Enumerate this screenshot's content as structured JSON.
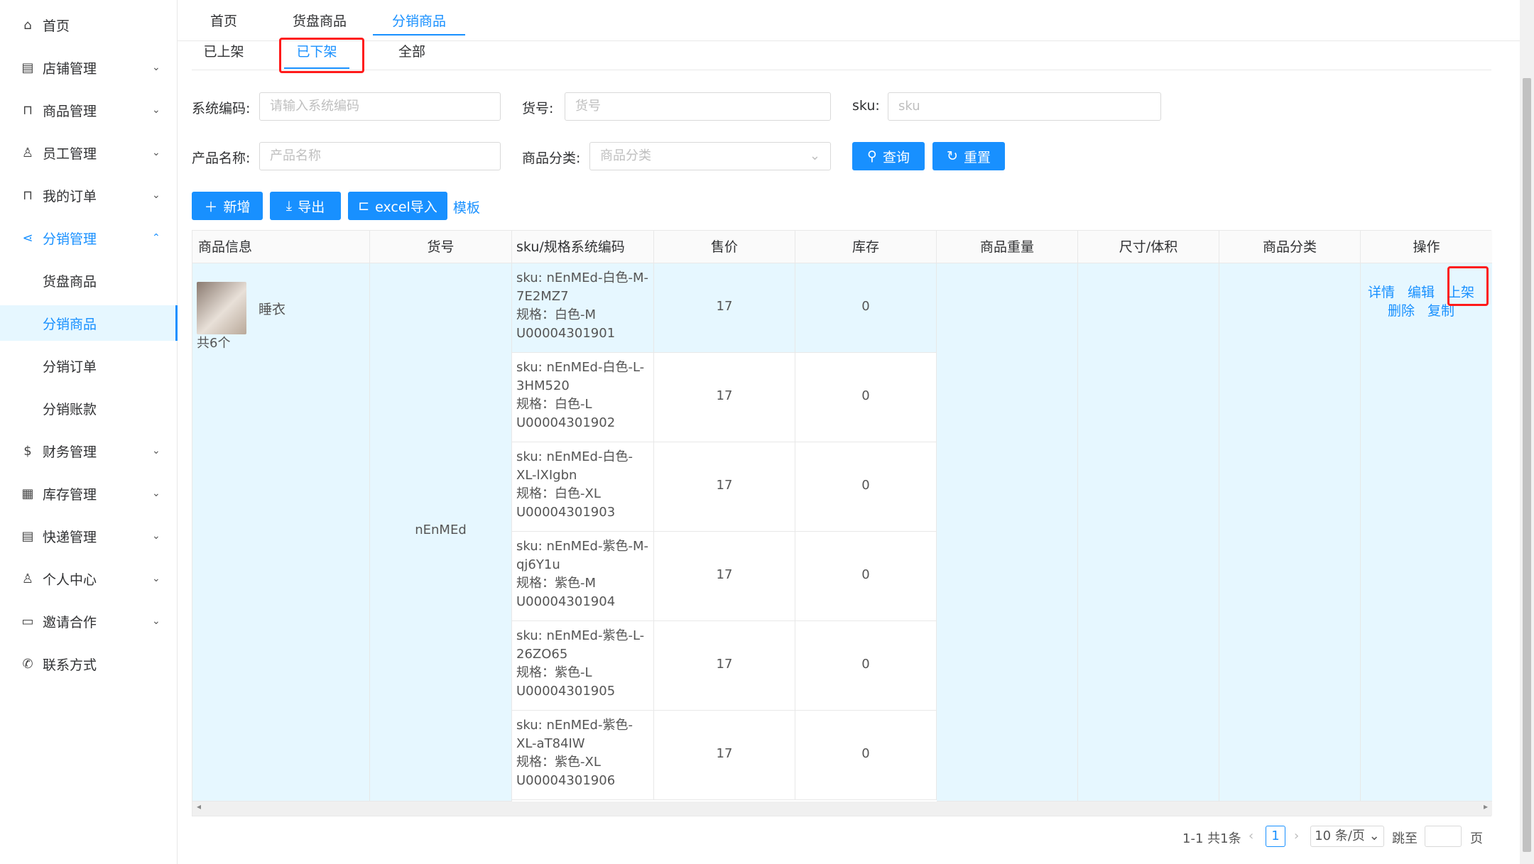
{
  "sidebar": {
    "items": [
      {
        "label": "首页",
        "icon": "home-icon"
      },
      {
        "label": "店铺管理",
        "icon": "shop-icon"
      },
      {
        "label": "商品管理",
        "icon": "bag-icon"
      },
      {
        "label": "员工管理",
        "icon": "user-icon"
      },
      {
        "label": "我的订单",
        "icon": "bag-icon"
      },
      {
        "label": "分销管理",
        "icon": "share-icon"
      },
      {
        "label": "货盘商品"
      },
      {
        "label": "分销商品"
      },
      {
        "label": "分销订单"
      },
      {
        "label": "分销账款"
      },
      {
        "label": "财务管理",
        "icon": "dollar-icon"
      },
      {
        "label": "库存管理",
        "icon": "table-icon"
      },
      {
        "label": "快递管理",
        "icon": "list-icon"
      },
      {
        "label": "个人中心",
        "icon": "user-icon"
      },
      {
        "label": "邀请合作",
        "icon": "laptop-icon"
      },
      {
        "label": "联系方式",
        "icon": "phone-icon"
      }
    ]
  },
  "top_tabs": [
    "首页",
    "货盘商品",
    "分销商品"
  ],
  "sub_tabs": [
    "已上架",
    "已下架",
    "全部"
  ],
  "filters": {
    "system_code": {
      "label": "系统编码:",
      "placeholder": "请输入系统编码"
    },
    "item_no": {
      "label": "货号:",
      "placeholder": "货号"
    },
    "sku": {
      "label": "sku:",
      "placeholder": "sku"
    },
    "product_name": {
      "label": "产品名称:",
      "placeholder": "产品名称"
    },
    "category": {
      "label": "商品分类:",
      "placeholder": "商品分类"
    },
    "query_label": "查询",
    "reset_label": "重置"
  },
  "actions": {
    "add": "新增",
    "export": "导出",
    "excel_import": "excel导入",
    "template": "模板"
  },
  "table": {
    "headers": [
      "商品信息",
      "货号",
      "sku/规格系统编码",
      "售价",
      "库存",
      "商品重量",
      "尺寸/体积",
      "商品分类",
      "操作"
    ],
    "product": {
      "name": "睡衣",
      "count": "共6个",
      "item_no": "nEnMEd"
    },
    "rows": [
      {
        "sku": "sku: nEnMEd-白色-M-7E2MZ7",
        "spec": "规格：白色-M",
        "code": "U00004301901",
        "price": "17",
        "stock": "0"
      },
      {
        "sku": "sku: nEnMEd-白色-L-3HM520",
        "spec": "规格：白色-L",
        "code": "U00004301902",
        "price": "17",
        "stock": "0"
      },
      {
        "sku": "sku: nEnMEd-白色-XL-lXIgbn",
        "spec": "规格：白色-XL",
        "code": "U00004301903",
        "price": "17",
        "stock": "0"
      },
      {
        "sku": "sku: nEnMEd-紫色-M-qj6Y1u",
        "spec": "规格：紫色-M",
        "code": "U00004301904",
        "price": "17",
        "stock": "0"
      },
      {
        "sku": "sku: nEnMEd-紫色-L-26ZO65",
        "spec": "规格：紫色-L",
        "code": "U00004301905",
        "price": "17",
        "stock": "0"
      },
      {
        "sku": "sku: nEnMEd-紫色-XL-aT84IW",
        "spec": "规格：紫色-XL",
        "code": "U00004301906",
        "price": "17",
        "stock": "0"
      }
    ],
    "ops": {
      "detail": "详情",
      "edit": "编辑",
      "shelve": "上架",
      "delete": "删除",
      "copy": "复制"
    }
  },
  "pagination": {
    "summary": "1-1 共1条",
    "current": "1",
    "page_size": "10 条/页",
    "jump_label": "跳至",
    "page_suffix": "页"
  }
}
